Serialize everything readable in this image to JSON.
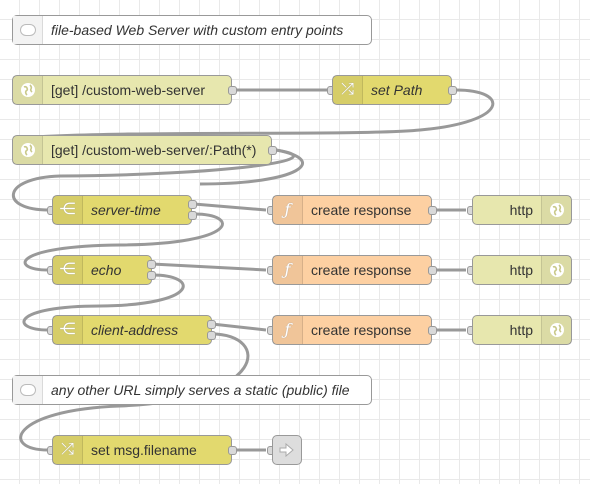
{
  "comments": [
    {
      "text": "file-based Web Server with custom entry points"
    },
    {
      "text": "any other URL simply serves a static (public) file"
    }
  ],
  "http_in": [
    {
      "label": "[get] /custom-web-server"
    },
    {
      "label": "[get] /custom-web-server/:Path(*)"
    }
  ],
  "change_nodes": [
    {
      "label": "set Path"
    },
    {
      "label": "set msg.filename"
    }
  ],
  "switch_nodes": [
    {
      "label": "server-time"
    },
    {
      "label": "echo"
    },
    {
      "label": "client-address"
    }
  ],
  "function_nodes": [
    {
      "label": "create response"
    },
    {
      "label": "create response"
    },
    {
      "label": "create response"
    }
  ],
  "http_response": [
    {
      "label": "http"
    },
    {
      "label": "http"
    },
    {
      "label": "http"
    }
  ],
  "icons": {
    "comment": "comment-bubble-icon",
    "http_in": "globe-icon",
    "change": "shuffle-icon",
    "switch": "fork-icon",
    "function": "function-icon",
    "http_response": "globe-icon",
    "link_out": "link-out-arrow-icon"
  },
  "colors": {
    "http": "#e7e7ae",
    "change": "#e2d96e",
    "switch": "#e2d96e",
    "function": "#fdd0a2",
    "comment": "#ffffff",
    "link": "#dddddd",
    "wire": "#999999",
    "grid": "#e9e9e9"
  }
}
